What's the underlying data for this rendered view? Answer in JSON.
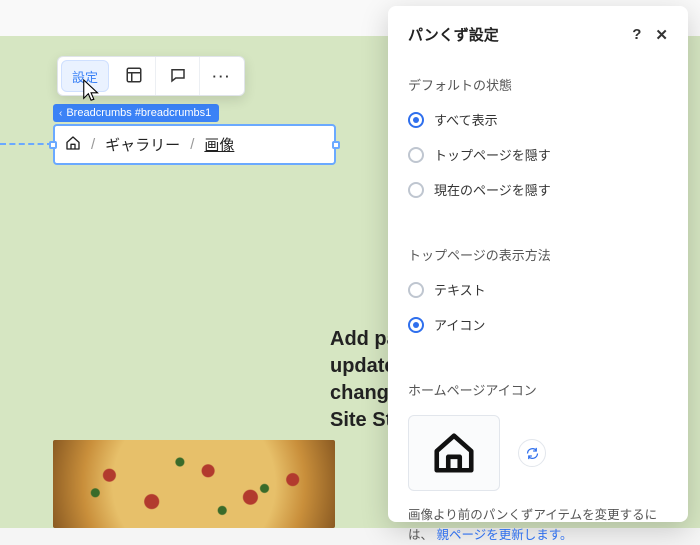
{
  "toolbar": {
    "settings_label": "設定"
  },
  "element_tag": {
    "label": "Breadcrumbs #breadcrumbs1"
  },
  "breadcrumb": {
    "items": [
      "ギャラリー",
      "画像"
    ],
    "separator": "/"
  },
  "placeholder_paragraph": "Add paragraphs, click \"Edit Text\" to update the font, size or scale. To change and reuse text themes, go to Site Styles.",
  "panel": {
    "title": "パンくず設定",
    "sections": {
      "default_state": {
        "title": "デフォルトの状態",
        "options": [
          {
            "label": "すべて表示",
            "selected": true
          },
          {
            "label": "トップページを隠す",
            "selected": false
          },
          {
            "label": "現在のページを隠す",
            "selected": false
          }
        ]
      },
      "home_display": {
        "title": "トップページの表示方法",
        "options": [
          {
            "label": "テキスト",
            "selected": false
          },
          {
            "label": "アイコン",
            "selected": true
          }
        ]
      },
      "home_icon": {
        "title": "ホームページアイコン"
      }
    },
    "footer_note_prefix": "画像より前のパンくずアイテムを変更するには、",
    "footer_note_link": "親ページを更新します。"
  }
}
